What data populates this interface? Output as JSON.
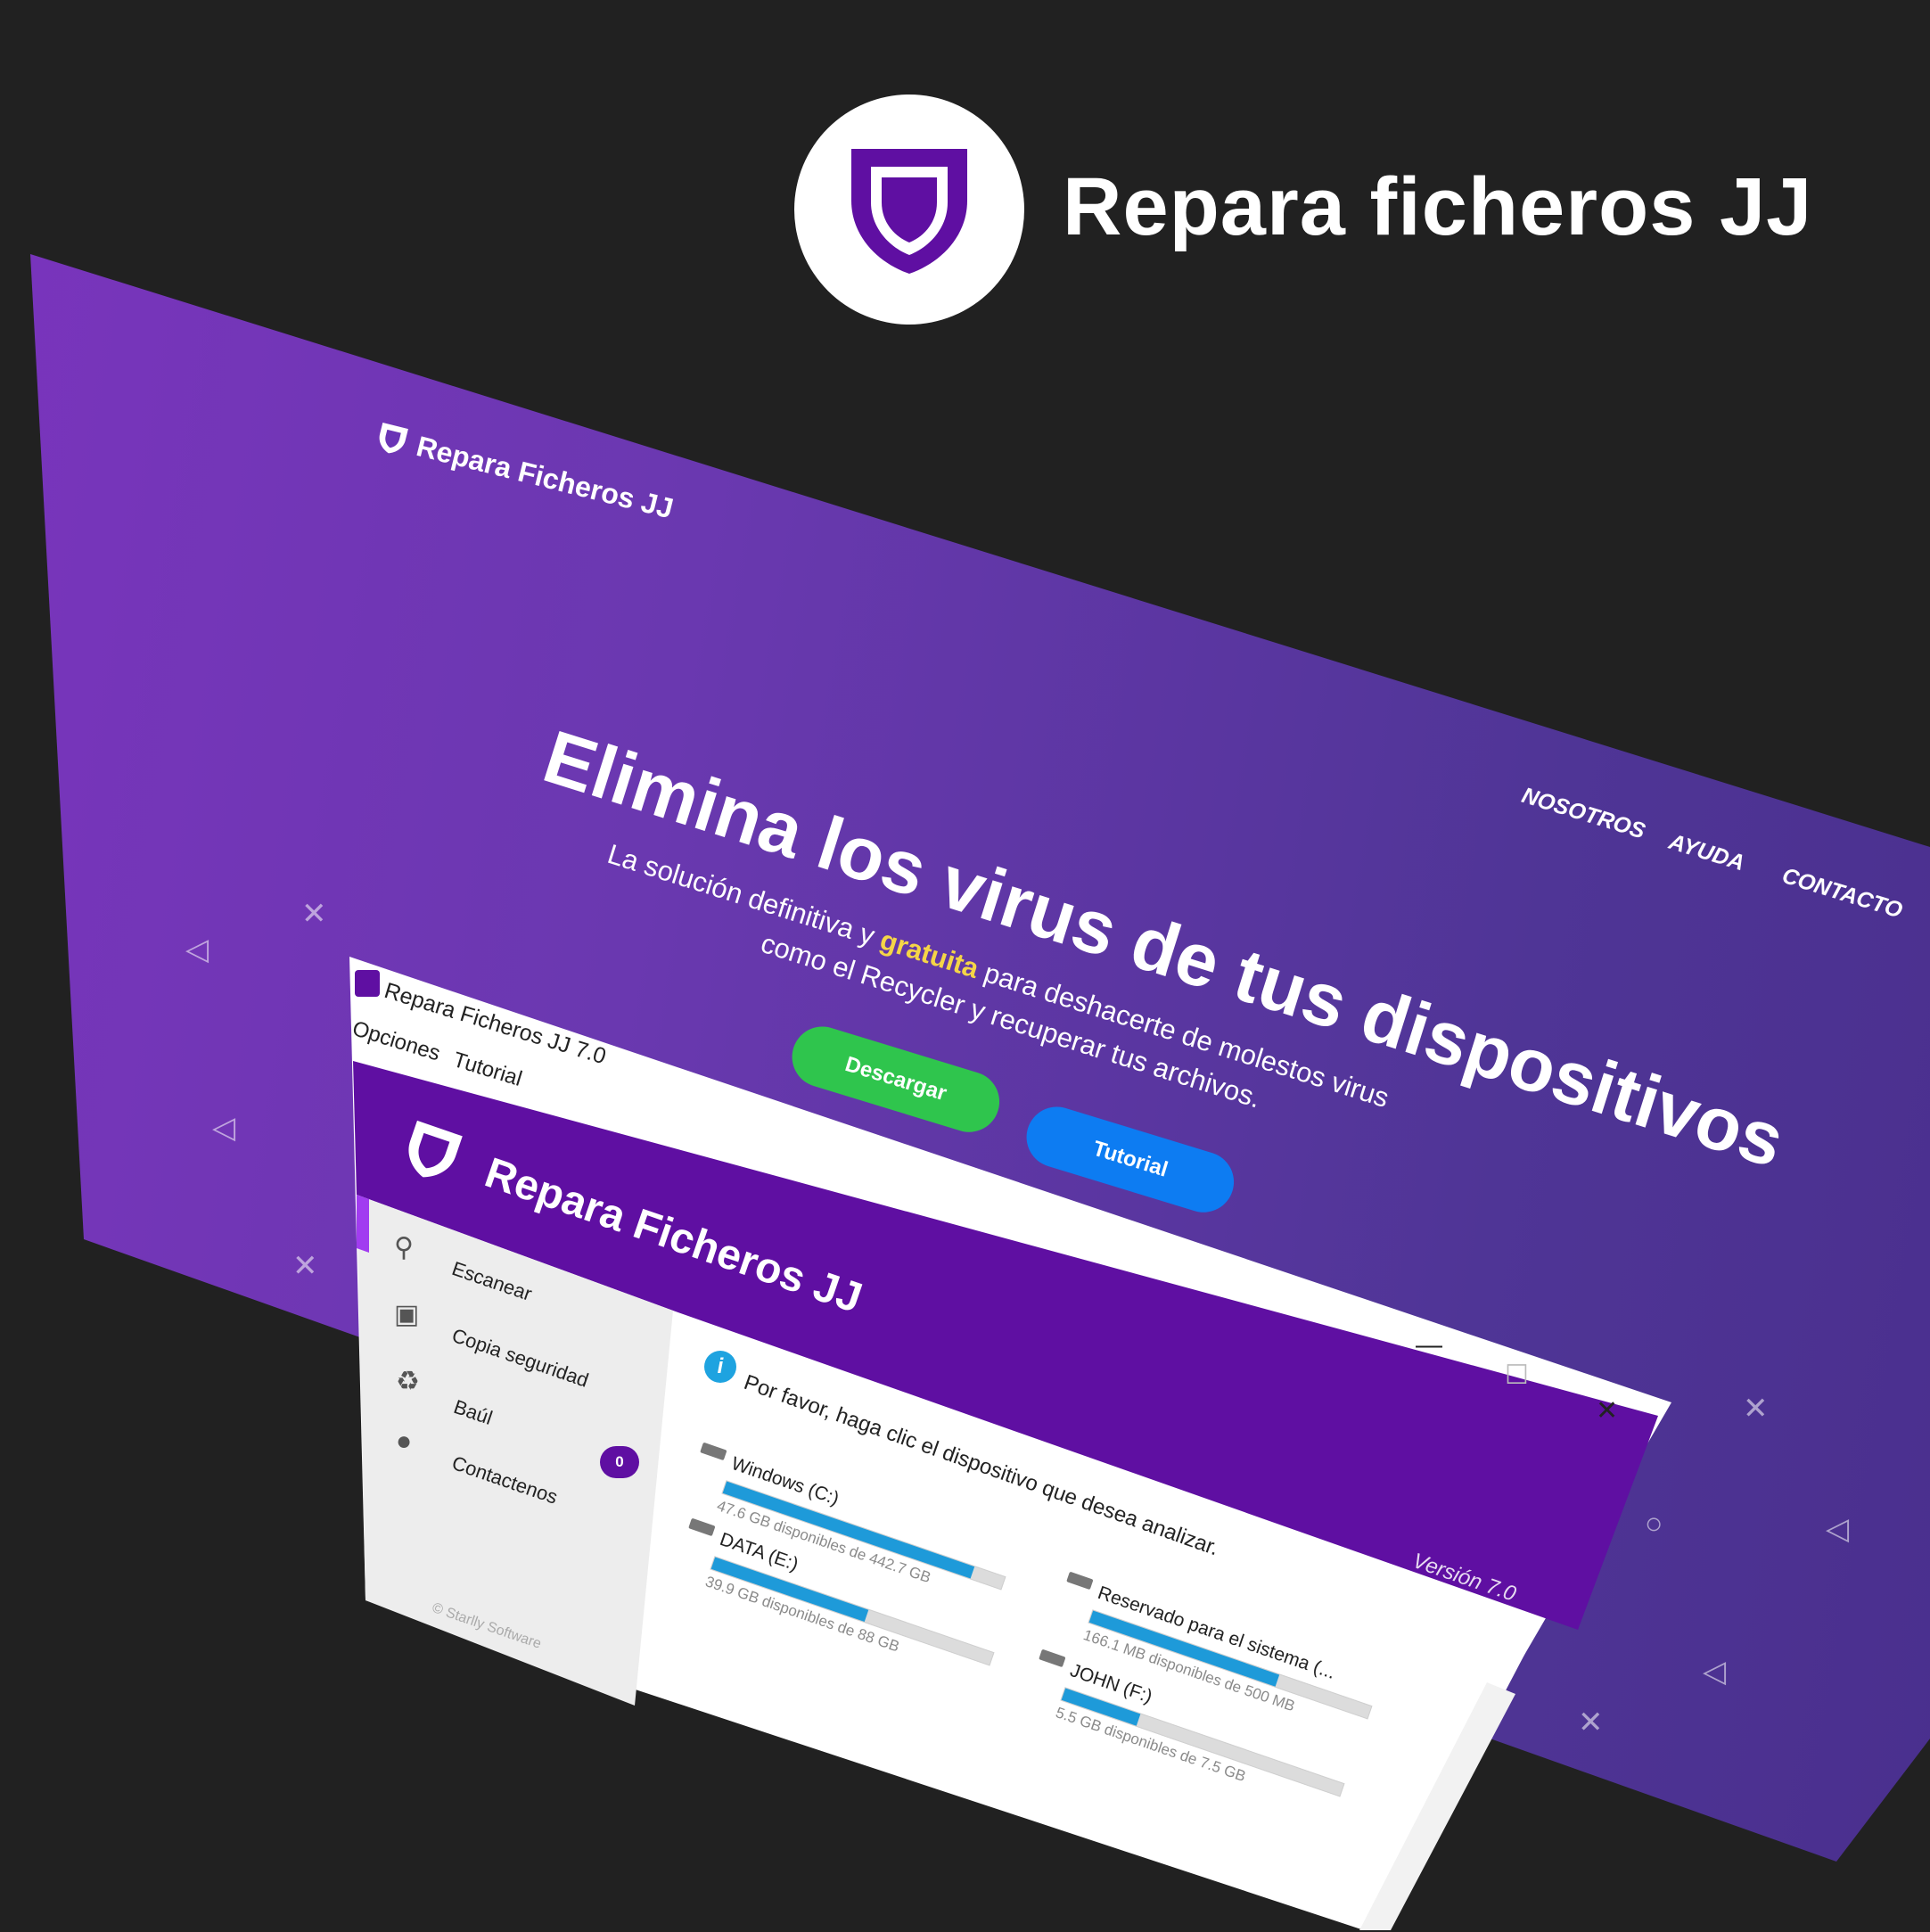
{
  "brand": {
    "title": "Repara ficheros JJ",
    "logo_icon": "shield-icon",
    "accent_color": "#5f0fa2"
  },
  "website": {
    "logo_text": "Repara Ficheros JJ",
    "nav": [
      "NOSOTROS",
      "AYUDA",
      "CONTACTO"
    ],
    "hero_title": "Elimina los virus de tus dispositivos",
    "hero_sub_line1_a": "La solución definitiva y ",
    "hero_sub_highlight": "gratuita",
    "hero_sub_line1_b": " para deshacerte de molestos virus",
    "hero_sub_line2": "como el Recycler y recuperar tus archivos.",
    "download_label": "Descargar",
    "tutorial_label": "Tutorial",
    "colors": {
      "download": "#2fc54d",
      "tutorial": "#0d7cf2",
      "highlight": "#f5d547"
    }
  },
  "app": {
    "window_title": "Repara Ficheros JJ 7.0",
    "menu": [
      "Opciones",
      "Tutorial"
    ],
    "app_name": "Repara Ficheros JJ",
    "sidebar": [
      {
        "label": "Escanear",
        "icon": "search-icon"
      },
      {
        "label": "Copia seguridad",
        "icon": "floppy-icon"
      },
      {
        "label": "Baúl",
        "icon": "recycle-icon"
      },
      {
        "label": "Contactenos",
        "icon": "user-icon"
      }
    ],
    "badge_count": "0",
    "copyright": "© Starlly Software",
    "info_message": "Por favor, haga clic el dispositivo que desea analizar.",
    "version": "Versión 7.0",
    "window_controls": {
      "minimize": "—",
      "maximize": "☐",
      "close": "✕"
    },
    "drives": [
      {
        "name": "Windows (C:)",
        "detail": "47.6 GB disponibles de 442.7 GB",
        "used_fraction": 0.89
      },
      {
        "name": "DATA (E:)",
        "detail": "39.9 GB disponibles de 88 GB",
        "used_fraction": 0.55
      },
      {
        "name": "Reservado para el sistema (...",
        "detail": "166.1 MB disponibles de 500 MB",
        "used_fraction": 0.67
      },
      {
        "name": "JOHN (F:)",
        "detail": "5.5 GB disponibles de 7.5 GB",
        "used_fraction": 0.27
      }
    ]
  }
}
